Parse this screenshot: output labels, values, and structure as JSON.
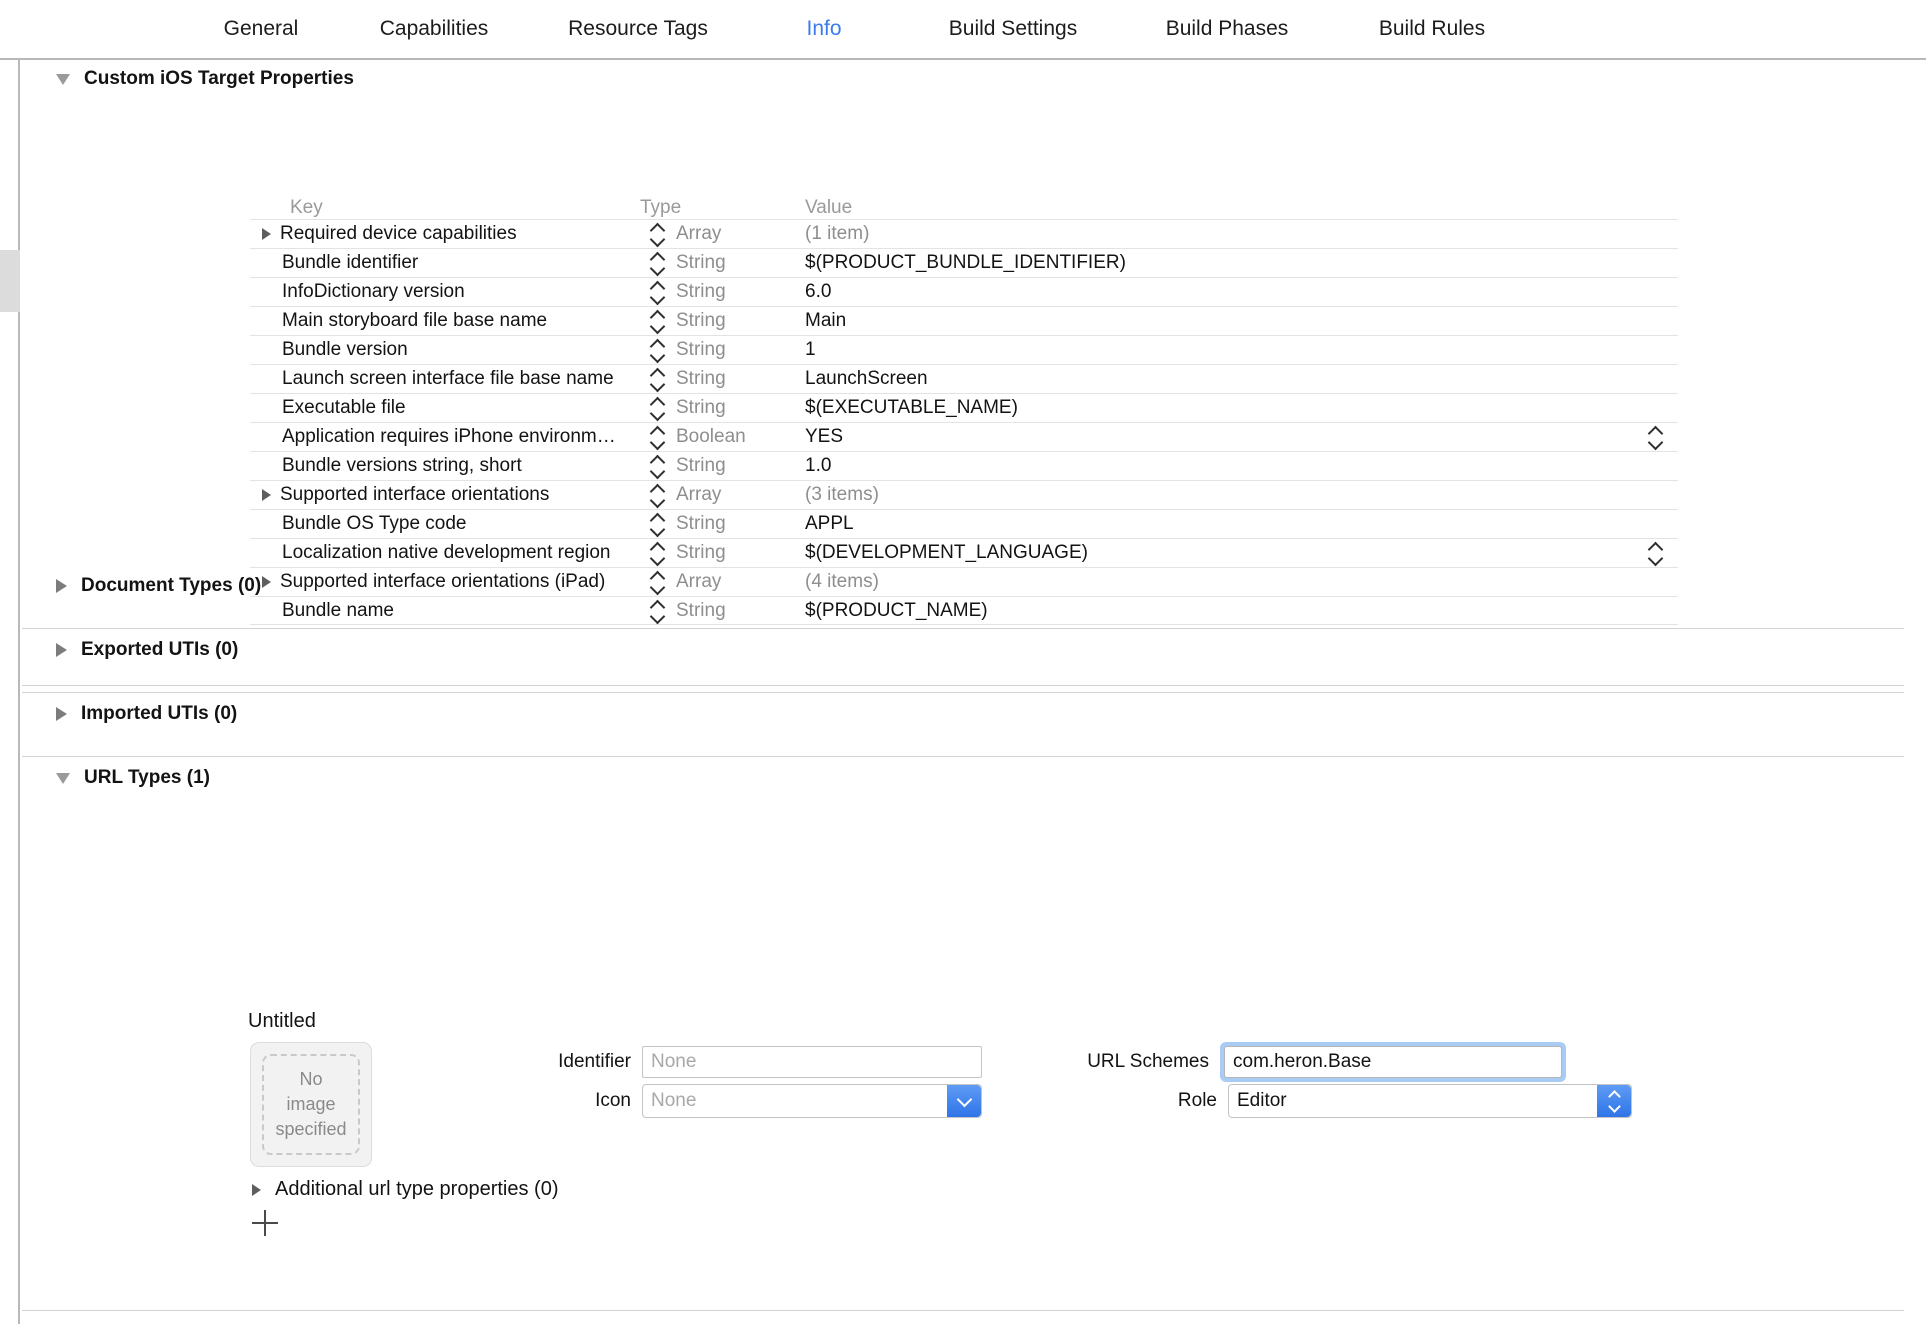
{
  "tabs": [
    {
      "label": "General",
      "selected": false
    },
    {
      "label": "Capabilities",
      "selected": false
    },
    {
      "label": "Resource Tags",
      "selected": false
    },
    {
      "label": "Info",
      "selected": true
    },
    {
      "label": "Build Settings",
      "selected": false
    },
    {
      "label": "Build Phases",
      "selected": false
    },
    {
      "label": "Build Rules",
      "selected": false
    }
  ],
  "accent_color": "#3b7bea",
  "sections": {
    "custom_properties": {
      "title": "Custom iOS Target Properties",
      "expanded": true,
      "columns": {
        "key": "Key",
        "type": "Type",
        "value": "Value"
      },
      "rows": [
        {
          "key": "Required device capabilities",
          "type": "Array",
          "value": "(1 item)",
          "dim": true,
          "expandable": true,
          "value_stepper": false
        },
        {
          "key": "Bundle identifier",
          "type": "String",
          "value": "$(PRODUCT_BUNDLE_IDENTIFIER)",
          "dim": false,
          "expandable": false,
          "value_stepper": false
        },
        {
          "key": "InfoDictionary version",
          "type": "String",
          "value": "6.0",
          "dim": false,
          "expandable": false,
          "value_stepper": false
        },
        {
          "key": "Main storyboard file base name",
          "type": "String",
          "value": "Main",
          "dim": false,
          "expandable": false,
          "value_stepper": false
        },
        {
          "key": "Bundle version",
          "type": "String",
          "value": "1",
          "dim": false,
          "expandable": false,
          "value_stepper": false
        },
        {
          "key": "Launch screen interface file base name",
          "type": "String",
          "value": "LaunchScreen",
          "dim": false,
          "expandable": false,
          "value_stepper": false
        },
        {
          "key": "Executable file",
          "type": "String",
          "value": "$(EXECUTABLE_NAME)",
          "dim": false,
          "expandable": false,
          "value_stepper": false
        },
        {
          "key": "Application requires iPhone environm…",
          "type": "Boolean",
          "value": "YES",
          "dim": false,
          "expandable": false,
          "value_stepper": true
        },
        {
          "key": "Bundle versions string, short",
          "type": "String",
          "value": "1.0",
          "dim": false,
          "expandable": false,
          "value_stepper": false
        },
        {
          "key": "Supported interface orientations",
          "type": "Array",
          "value": "(3 items)",
          "dim": true,
          "expandable": true,
          "value_stepper": false
        },
        {
          "key": "Bundle OS Type code",
          "type": "String",
          "value": "APPL",
          "dim": false,
          "expandable": false,
          "value_stepper": false
        },
        {
          "key": "Localization native development region",
          "type": "String",
          "value": "$(DEVELOPMENT_LANGUAGE)",
          "dim": false,
          "expandable": false,
          "value_stepper": true
        },
        {
          "key": "Supported interface orientations (iPad)",
          "type": "Array",
          "value": "(4 items)",
          "dim": true,
          "expandable": true,
          "value_stepper": false
        },
        {
          "key": "Bundle name",
          "type": "String",
          "value": "$(PRODUCT_NAME)",
          "dim": false,
          "expandable": false,
          "value_stepper": false
        }
      ]
    },
    "document_types": {
      "title": "Document Types (0)",
      "expanded": false
    },
    "exported_utis": {
      "title": "Exported UTIs (0)",
      "expanded": false
    },
    "imported_utis": {
      "title": "Imported UTIs (0)",
      "expanded": false
    },
    "url_types": {
      "title": "URL Types (1)",
      "expanded": true,
      "entry": {
        "name": "Untitled",
        "icon_well_text": "No\nimage\nspecified",
        "icon_well_line1": "No",
        "icon_well_line2": "image",
        "icon_well_line3": "specified",
        "fields": {
          "identifier_label": "Identifier",
          "identifier_value": "",
          "identifier_placeholder": "None",
          "icon_label": "Icon",
          "icon_value": "",
          "icon_placeholder": "None",
          "url_schemes_label": "URL Schemes",
          "url_schemes_value": "com.heron.Base",
          "role_label": "Role",
          "role_value": "Editor"
        },
        "additional_properties_label": "Additional url type properties (0)",
        "add_button_label": "+"
      }
    }
  }
}
